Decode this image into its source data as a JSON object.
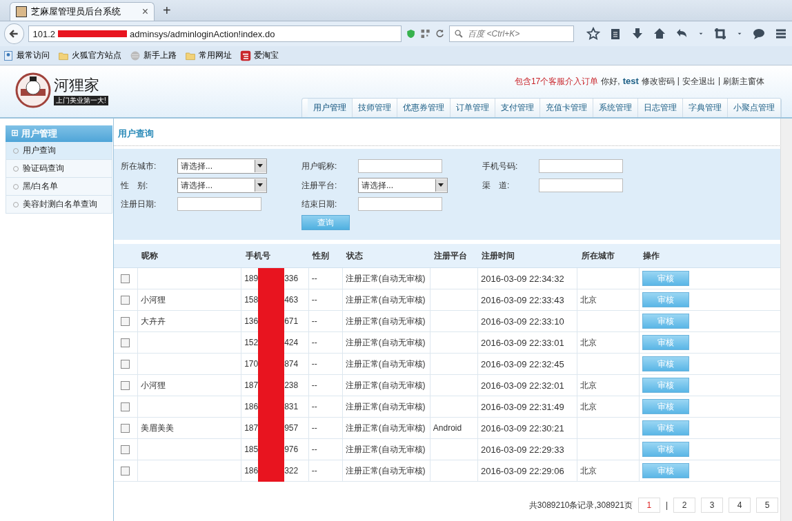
{
  "browser": {
    "tab_title": "芝麻屋管理员后台系统",
    "tab_close": "×",
    "new_tab": "+",
    "url_start": "101.2",
    "url_end": "adminsys/adminloginAction!index.do",
    "search_placeholder": "百度 <Ctrl+K>",
    "bookmarks": [
      {
        "label": "最常访问",
        "kind": "page"
      },
      {
        "label": "火狐官方站点",
        "kind": "folder"
      },
      {
        "label": "新手上路",
        "kind": "globe"
      },
      {
        "label": "常用网址",
        "kind": "folder"
      },
      {
        "label": "爱淘宝",
        "kind": "taobao"
      }
    ]
  },
  "header": {
    "logo_text": "河狸家",
    "logo_tagline": "上门美业第一大!",
    "notice": "包含17个客服介入订单",
    "greeting": "你好,",
    "user": "test",
    "links": [
      "修改密码",
      "安全退出",
      "刷新主窗体"
    ],
    "link_separators": [
      "|",
      "|"
    ],
    "nav": [
      {
        "label": "用户管理",
        "selected": true
      },
      {
        "label": "技师管理",
        "selected": false
      },
      {
        "label": "优惠券管理",
        "selected": false
      },
      {
        "label": "订单管理",
        "selected": false
      },
      {
        "label": "支付管理",
        "selected": false
      },
      {
        "label": "充值卡管理",
        "selected": false
      },
      {
        "label": "系统管理",
        "selected": false
      },
      {
        "label": "日志管理",
        "selected": false
      },
      {
        "label": "字典管理",
        "selected": false
      },
      {
        "label": "小聚点管理",
        "selected": false
      }
    ]
  },
  "sidebar": {
    "title": "用户管理",
    "expand_icon": "⊞",
    "items": [
      {
        "label": "用户查询",
        "selected": true
      },
      {
        "label": "验证码查询",
        "selected": false
      },
      {
        "label": "黑/白名单",
        "selected": false
      },
      {
        "label": "美容封测白名单查询",
        "selected": false
      }
    ]
  },
  "panel_title": "用户查询",
  "filters": [
    {
      "label": "所在城市:",
      "kind": "select",
      "value": "请选择..."
    },
    {
      "label": "用户昵称:",
      "kind": "text"
    },
    {
      "label": "手机号码:",
      "kind": "text"
    },
    {
      "label": "性　别:",
      "kind": "select",
      "value": "请选择..."
    },
    {
      "label": "注册平台:",
      "kind": "select",
      "value": "请选择..."
    },
    {
      "label": "渠　道:",
      "kind": "text"
    },
    {
      "label": "注册日期:",
      "kind": "text"
    },
    {
      "label": "结束日期:",
      "kind": "text"
    },
    {
      "label": "查询",
      "kind": "button"
    }
  ],
  "table": {
    "columns": [
      "昵称",
      "手机号",
      "性别",
      "状态",
      "注册平台",
      "注册时间",
      "所在城市",
      "操作"
    ],
    "rows": [
      {
        "checked": false,
        "nickname": "",
        "phone_start": "189",
        "phone_end": "336",
        "gender": "--",
        "status": "注册正常(自动无审核)",
        "platform": "",
        "time": "2016-03-09 22:34:32",
        "action": "审核",
        "city": ""
      },
      {
        "checked": false,
        "nickname": "小河狸",
        "phone_start": "158",
        "phone_end": "463",
        "gender": "--",
        "status": "注册正常(自动无审核)",
        "platform": "",
        "time": "2016-03-09 22:33:43",
        "action": "审核",
        "city": "北京"
      },
      {
        "checked": false,
        "nickname": "大卉卉",
        "phone_start": "136",
        "phone_end": "671",
        "gender": "--",
        "status": "注册正常(自动无审核)",
        "platform": "",
        "time": "2016-03-09 22:33:10",
        "action": "审核",
        "city": ""
      },
      {
        "checked": false,
        "nickname": "",
        "phone_start": "152",
        "phone_end": "424",
        "gender": "--",
        "status": "注册正常(自动无审核)",
        "platform": "",
        "time": "2016-03-09 22:33:01",
        "action": "审核",
        "city": "北京"
      },
      {
        "checked": false,
        "nickname": "",
        "phone_start": "170",
        "phone_end": "874",
        "gender": "--",
        "status": "注册正常(自动无审核)",
        "platform": "",
        "time": "2016-03-09 22:32:45",
        "action": "审核",
        "city": ""
      },
      {
        "checked": false,
        "nickname": "小河狸",
        "phone_start": "187",
        "phone_end": "238",
        "gender": "--",
        "status": "注册正常(自动无审核)",
        "platform": "",
        "time": "2016-03-09 22:32:01",
        "action": "审核",
        "city": "北京"
      },
      {
        "checked": false,
        "nickname": "",
        "phone_start": "186",
        "phone_end": "831",
        "gender": "--",
        "status": "注册正常(自动无审核)",
        "platform": "",
        "time": "2016-03-09 22:31:49",
        "action": "审核",
        "city": "北京"
      },
      {
        "checked": false,
        "nickname": "美眉美美",
        "phone_start": "187",
        "phone_end": "957",
        "gender": "--",
        "status": "注册正常(自动无审核)",
        "platform": "Android",
        "time": "2016-03-09 22:30:21",
        "action": "审核",
        "city": ""
      },
      {
        "checked": false,
        "nickname": "",
        "phone_start": "185",
        "phone_end": "976",
        "gender": "--",
        "status": "注册正常(自动无审核)",
        "platform": "",
        "time": "2016-03-09 22:29:33",
        "action": "审核",
        "city": ""
      },
      {
        "checked": false,
        "nickname": "",
        "phone_start": "186",
        "phone_end": "322",
        "gender": "--",
        "status": "注册正常(自动无审核)",
        "platform": "",
        "time": "2016-03-09 22:29:06",
        "action": "审核",
        "city": "北京"
      }
    ]
  },
  "pagination": {
    "summary": "共3089210条记录,308921页",
    "separator": "|",
    "pages": [
      {
        "label": "1",
        "selected": true
      },
      {
        "label": "2",
        "selected": false
      },
      {
        "label": "3",
        "selected": false
      },
      {
        "label": "4",
        "selected": false
      },
      {
        "label": "5",
        "selected": false
      }
    ]
  }
}
